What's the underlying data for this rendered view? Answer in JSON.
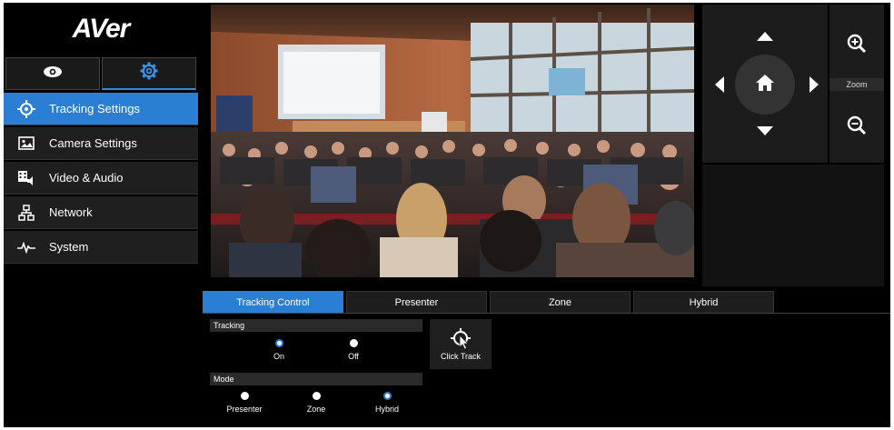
{
  "brand": {
    "logo": "AVer"
  },
  "sidebar": {
    "items": [
      {
        "label": "Tracking Settings",
        "icon": "crosshair-icon",
        "active": true
      },
      {
        "label": "Camera Settings",
        "icon": "image-icon",
        "active": false
      },
      {
        "label": "Video & Audio",
        "icon": "video-audio-icon",
        "active": false
      },
      {
        "label": "Network",
        "icon": "network-icon",
        "active": false
      },
      {
        "label": "System",
        "icon": "pulse-icon",
        "active": false
      }
    ]
  },
  "ptz": {
    "zoom_label": "Zoom"
  },
  "tabs": [
    {
      "label": "Tracking Control",
      "active": true
    },
    {
      "label": "Presenter",
      "active": false
    },
    {
      "label": "Zone",
      "active": false
    },
    {
      "label": "Hybrid",
      "active": false
    }
  ],
  "tracking": {
    "title": "Tracking",
    "options": [
      {
        "label": "On",
        "selected": true
      },
      {
        "label": "Off",
        "selected": false
      }
    ]
  },
  "mode": {
    "title": "Mode",
    "options": [
      {
        "label": "Presenter",
        "selected": false
      },
      {
        "label": "Zone",
        "selected": false
      },
      {
        "label": "Hybrid",
        "selected": true
      }
    ]
  },
  "click_track": {
    "label": "Click Track"
  },
  "colors": {
    "accent": "#2a7fd4",
    "background": "#000000",
    "panel": "#1f1f1f"
  }
}
